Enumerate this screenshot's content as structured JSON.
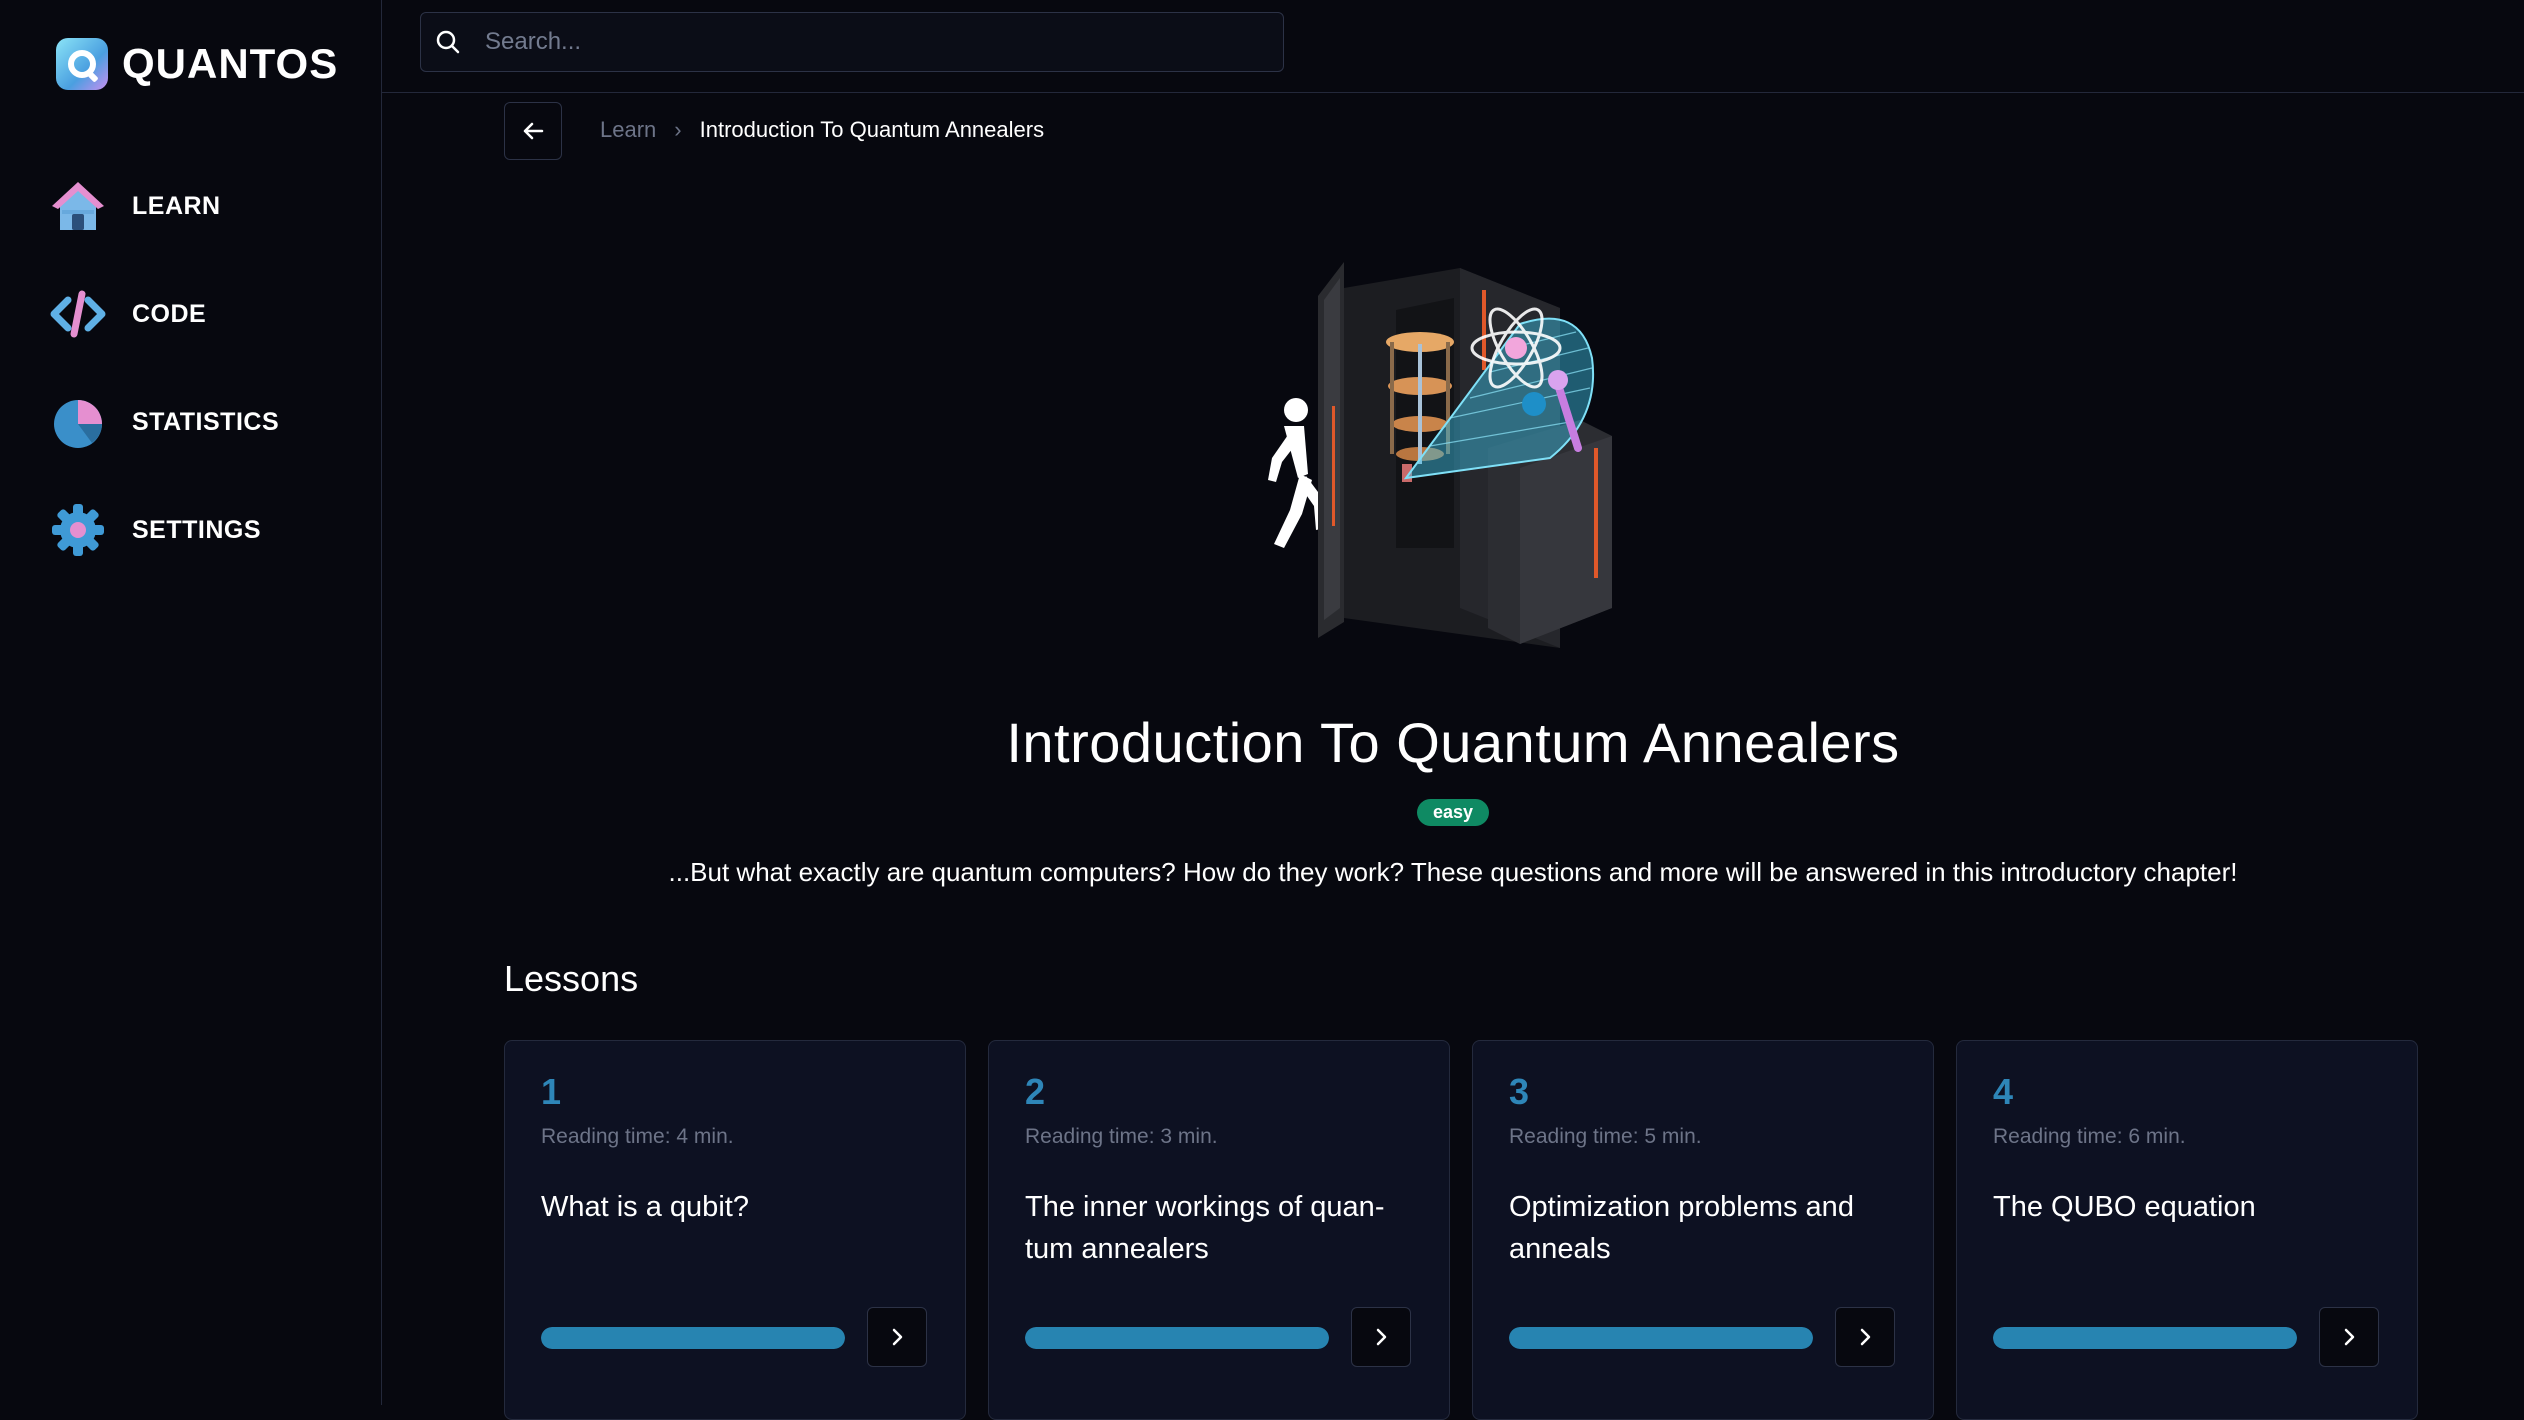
{
  "brand": {
    "name": "QUANTOS"
  },
  "sidebar": {
    "items": [
      {
        "label": "LEARN",
        "icon": "home-icon"
      },
      {
        "label": "CODE",
        "icon": "code-icon"
      },
      {
        "label": "STATISTICS",
        "icon": "pie-chart-icon"
      },
      {
        "label": "SETTINGS",
        "icon": "gear-icon"
      }
    ]
  },
  "search": {
    "placeholder": "Search..."
  },
  "breadcrumb": {
    "parent": "Learn",
    "separator": "›",
    "current": "Introduction To Quantum Annealers"
  },
  "course": {
    "title": "Introduction To Quantum Annealers",
    "difficulty": "easy",
    "description": "...But what exactly are quantum computers? How do they work? These questions and more will be answered in this introductory chapter!"
  },
  "lessons": {
    "heading": "Lessons",
    "items": [
      {
        "number": "1",
        "reading_time": "Reading time: 4 min.",
        "title": "What is a qubit?",
        "progress": 1.0
      },
      {
        "number": "2",
        "reading_time": "Reading time: 3 min.",
        "title": "The inner workings of quan-tum annealers",
        "progress": 1.0
      },
      {
        "number": "3",
        "reading_time": "Reading time: 5 min.",
        "title": "Optimization problems and anneals",
        "progress": 1.0
      },
      {
        "number": "4",
        "reading_time": "Reading time: 6 min.",
        "title": "The QUBO equation",
        "progress": 1.0
      }
    ]
  },
  "colors": {
    "background": "#07080f",
    "accent": "#2784b1",
    "badge": "#0f8a63"
  }
}
